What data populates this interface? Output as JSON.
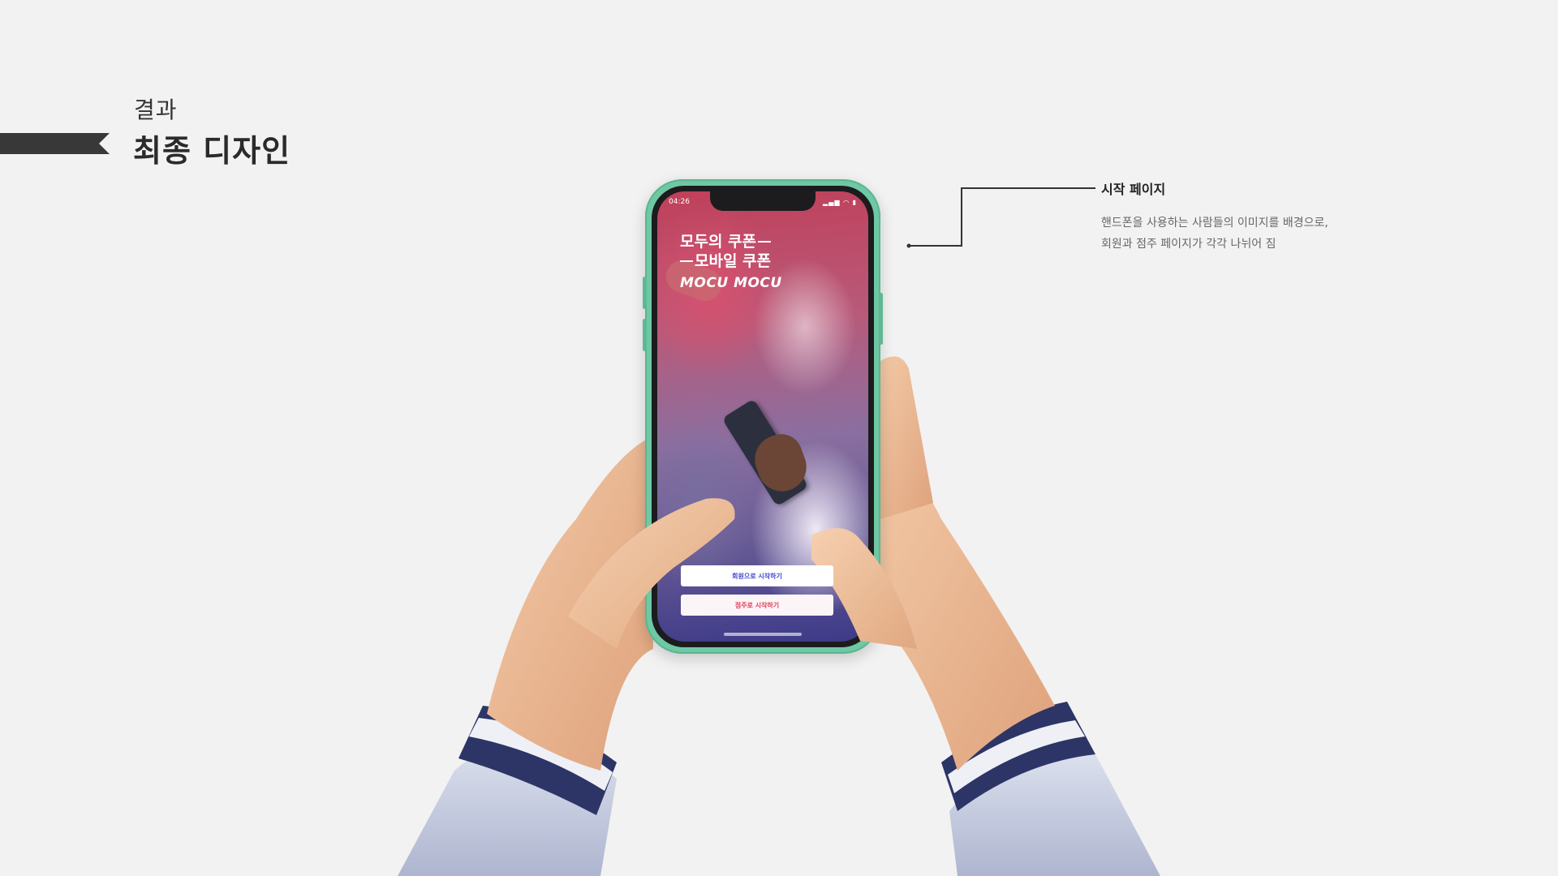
{
  "section": {
    "eyebrow": "결과",
    "title": "최종 디자인"
  },
  "callout": {
    "title": "시작 페이지",
    "description_lines": [
      "핸드폰을 사용하는 사람들의 이미지를 배경으로,",
      "회원과 점주 페이지가 각각 나뉘어 짐"
    ]
  },
  "phone_screen": {
    "status_time": "04:26",
    "headline_lines": [
      "모두의 쿠폰",
      "모바일 쿠폰"
    ],
    "brand": "MOCU MOCU",
    "buttons": {
      "member_start": "회원으로 시작하기",
      "owner_start": "점주로 시작하기"
    }
  },
  "colors": {
    "background": "#f2f2f2",
    "accent_dark": "#333333",
    "phone_frame": "#6fc8a4",
    "member_button_text": "#3f48c8",
    "owner_button_text": "#e0405a"
  },
  "icons": [
    "location-arrow-icon",
    "signal-icon",
    "wifi-icon",
    "battery-icon"
  ]
}
